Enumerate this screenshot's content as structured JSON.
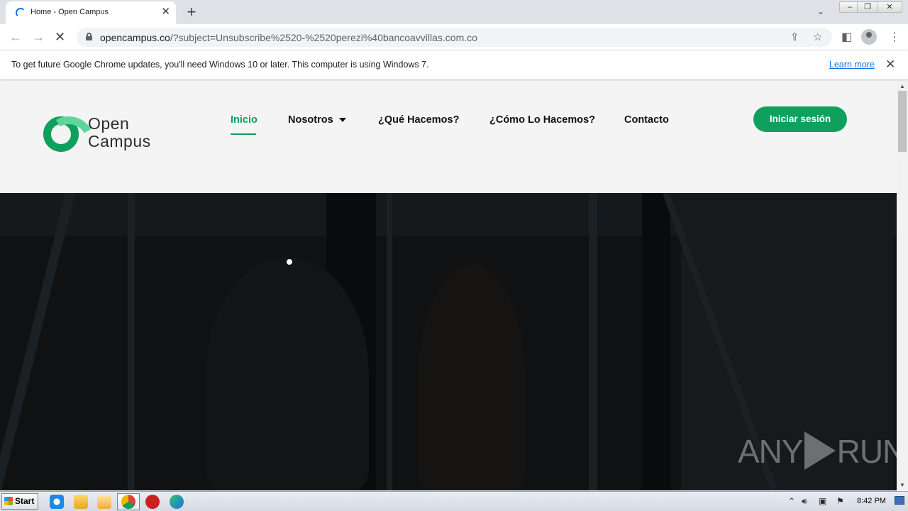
{
  "browser": {
    "tab_title": "Home - Open Campus",
    "new_tab_icon": "+",
    "tab_close_icon": "✕",
    "url_host": "opencampus.co",
    "url_rest": "/?subject=Unsubscribe%2520-%2520perezi%40bancoavvillas.com.co"
  },
  "infobar": {
    "message": "To get future Google Chrome updates, you'll need Windows 10 or later. This computer is using Windows 7.",
    "link": "Learn more"
  },
  "site": {
    "logo_line1": "Open",
    "logo_line2": "Campus",
    "nav": [
      {
        "label": "Inicio",
        "active": true
      },
      {
        "label": "Nosotros"
      },
      {
        "label": "¿Qué Hacemos?"
      },
      {
        "label": "¿Cómo Lo Hacemos?"
      },
      {
        "label": "Contacto"
      }
    ],
    "login_label": "Iniciar sesión",
    "accent_color": "#0fa05e"
  },
  "watermark": {
    "left": "ANY",
    "right": "RUN"
  },
  "taskbar": {
    "start_label": "Start",
    "clock": "8:42 PM"
  }
}
